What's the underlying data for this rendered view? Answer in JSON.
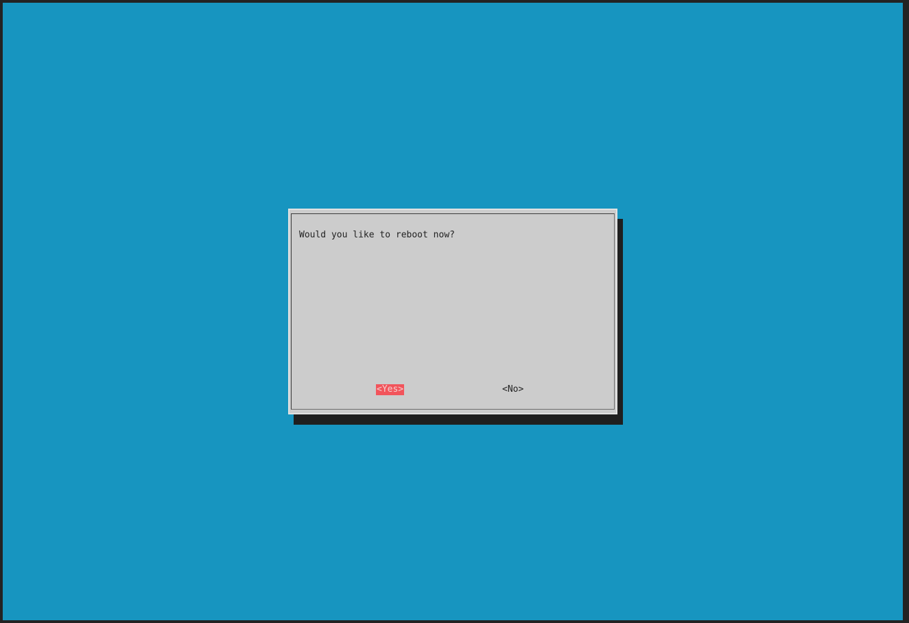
{
  "screen": {
    "background": "#1795c0"
  },
  "dialog": {
    "message": "Would you like to reboot now?",
    "buttons": {
      "yes_label": "<Yes>",
      "no_label": "<No>"
    },
    "selected_button": "yes",
    "selected_color": "#f2545b"
  }
}
